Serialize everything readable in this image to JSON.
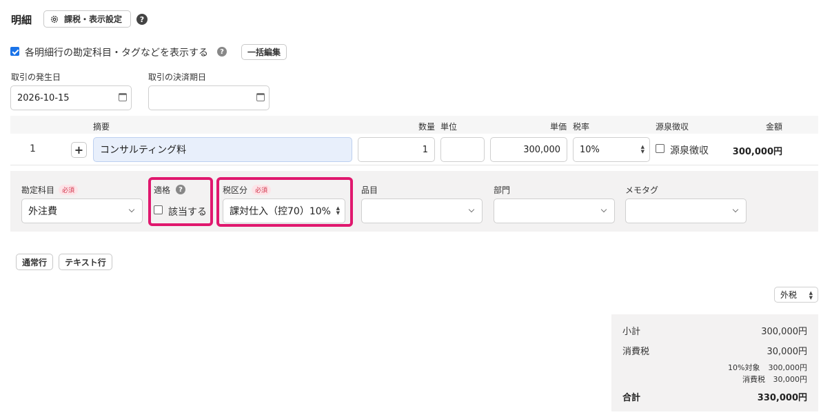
{
  "header": {
    "title": "明細",
    "settings_label": "課税・表示設定",
    "help": "?"
  },
  "options": {
    "show_account_tags_label": "各明細行の勘定科目・タグなどを表示する",
    "show_account_tags_checked": true,
    "bulk_edit_label": "一括編集"
  },
  "dates": {
    "issue_label": "取引の発生日",
    "issue_value": "2026-10-15",
    "due_label": "取引の決済期日",
    "due_value": ""
  },
  "table": {
    "headers": {
      "description": "摘要",
      "quantity": "数量",
      "unit": "単位",
      "unit_price": "単価",
      "tax_rate": "税率",
      "withholding": "源泉徴収",
      "amount": "金額"
    },
    "rows": [
      {
        "no": "1",
        "add": "+",
        "description": "コンサルティング料",
        "quantity": "1",
        "unit": "",
        "unit_price": "300,000",
        "tax_rate": "10%",
        "withholding_label": "源泉徴収",
        "withholding_checked": false,
        "amount": "300,000円"
      }
    ]
  },
  "details": {
    "account_label": "勘定科目",
    "account_required": "必須",
    "account_value": "外注費",
    "qualified_label": "適格",
    "qualified_check_label": "該当する",
    "qualified_checked": false,
    "tax_category_label": "税区分",
    "tax_category_required": "必須",
    "tax_category_value": "課対仕入（控70）10%",
    "item_label": "品目",
    "item_value": "",
    "department_label": "部門",
    "department_value": "",
    "memo_tag_label": "メモタグ",
    "memo_tag_value": ""
  },
  "add_row": {
    "normal_label": "通常行",
    "text_label": "テキスト行"
  },
  "tax_mode": {
    "value": "外税"
  },
  "summary": {
    "subtotal_label": "小計",
    "subtotal_value": "300,000円",
    "tax_label": "消費税",
    "tax_value": "30,000円",
    "breakdown_target_label": "10%対象",
    "breakdown_target_value": "300,000円",
    "breakdown_tax_label": "消費税",
    "breakdown_tax_value": "30,000円",
    "total_label": "合計",
    "total_value": "330,000円"
  },
  "colors": {
    "highlight": "#e0186e",
    "panel_bg": "#f3f2f2",
    "description_bg": "#e8effb",
    "required_badge": "#d2334a",
    "checkbox_checked": "#1a73e8"
  },
  "icons": {
    "settings": "gear-icon",
    "help": "help-circle-icon",
    "calendar": "calendar-icon",
    "add": "plus-icon",
    "select": "chevron-down-icon",
    "spinner": "up-down-icon"
  }
}
